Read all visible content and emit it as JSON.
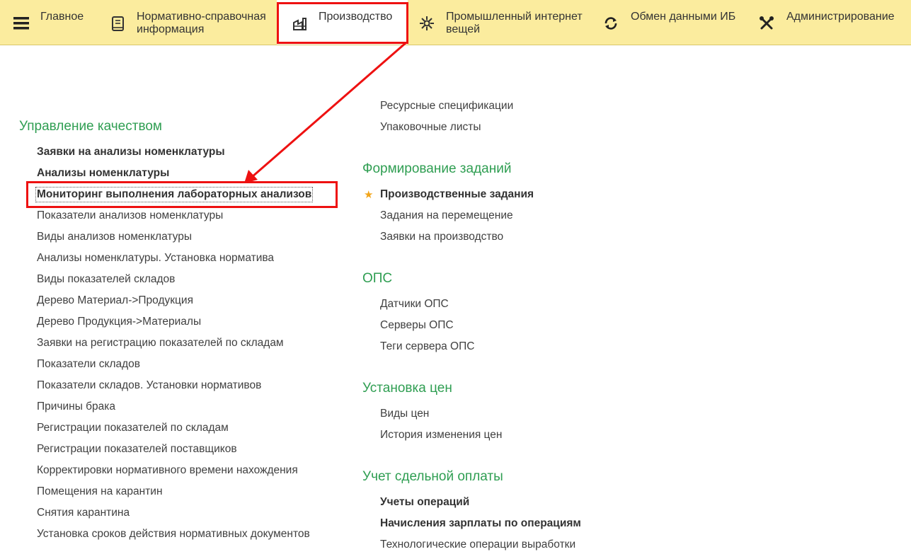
{
  "topnav": {
    "main": "Главное",
    "nsi_line1": "Нормативно-справочная",
    "nsi_line2": "информация",
    "production": "Производство",
    "iiot_line1": "Промышленный интернет",
    "iiot_line2": "вещей",
    "exchange": "Обмен данными ИБ",
    "admin": "Администрирование"
  },
  "left": {
    "title": "Управление качеством",
    "items": [
      "Заявки на анализы номенклатуры",
      "Анализы номенклатуры",
      "Мониторинг выполнения лабораторных анализов",
      "Показатели анализов номенклатуры",
      "Виды анализов номенклатуры",
      "Анализы номенклатуры. Установка норматива",
      "Виды показателей складов",
      "Дерево Материал->Продукция",
      "Дерево Продукция->Материалы",
      "Заявки на регистрацию показателей по складам",
      "Показатели складов",
      "Показатели складов. Установки нормативов",
      "Причины брака",
      "Регистрации показателей по складам",
      "Регистрации показателей поставщиков",
      "Корректировки нормативного времени нахождения",
      "Помещения на карантин",
      "Снятия карантина",
      "Установка сроков действия нормативных документов"
    ]
  },
  "right": {
    "top_items": [
      "Ресурсные спецификации",
      "Упаковочные листы"
    ],
    "tasks": {
      "title": "Формирование заданий",
      "items": [
        "Производственные задания",
        "Задания на перемещение",
        "Заявки на производство"
      ]
    },
    "ops": {
      "title": "ОПС",
      "items": [
        "Датчики ОПС",
        "Серверы ОПС",
        "Теги сервера ОПС"
      ]
    },
    "prices": {
      "title": "Установка цен",
      "items": [
        "Виды цен",
        "История изменения цен"
      ]
    },
    "piecework": {
      "title": "Учет сдельной оплаты",
      "items": [
        "Учеты операций",
        "Начисления зарплаты по операциям",
        "Технологические операции выработки"
      ]
    }
  },
  "colors": {
    "topbar": "#fbec9e",
    "section_green": "#2f9e52",
    "highlight_red": "#ee1111",
    "star": "#f2a51a"
  },
  "icons": {
    "menu": "hamburger-icon",
    "nsi": "book-icon",
    "production": "factory-icon",
    "iiot": "network-icon",
    "exchange": "sync-icon",
    "admin": "tools-icon",
    "favorite": "star-icon"
  }
}
